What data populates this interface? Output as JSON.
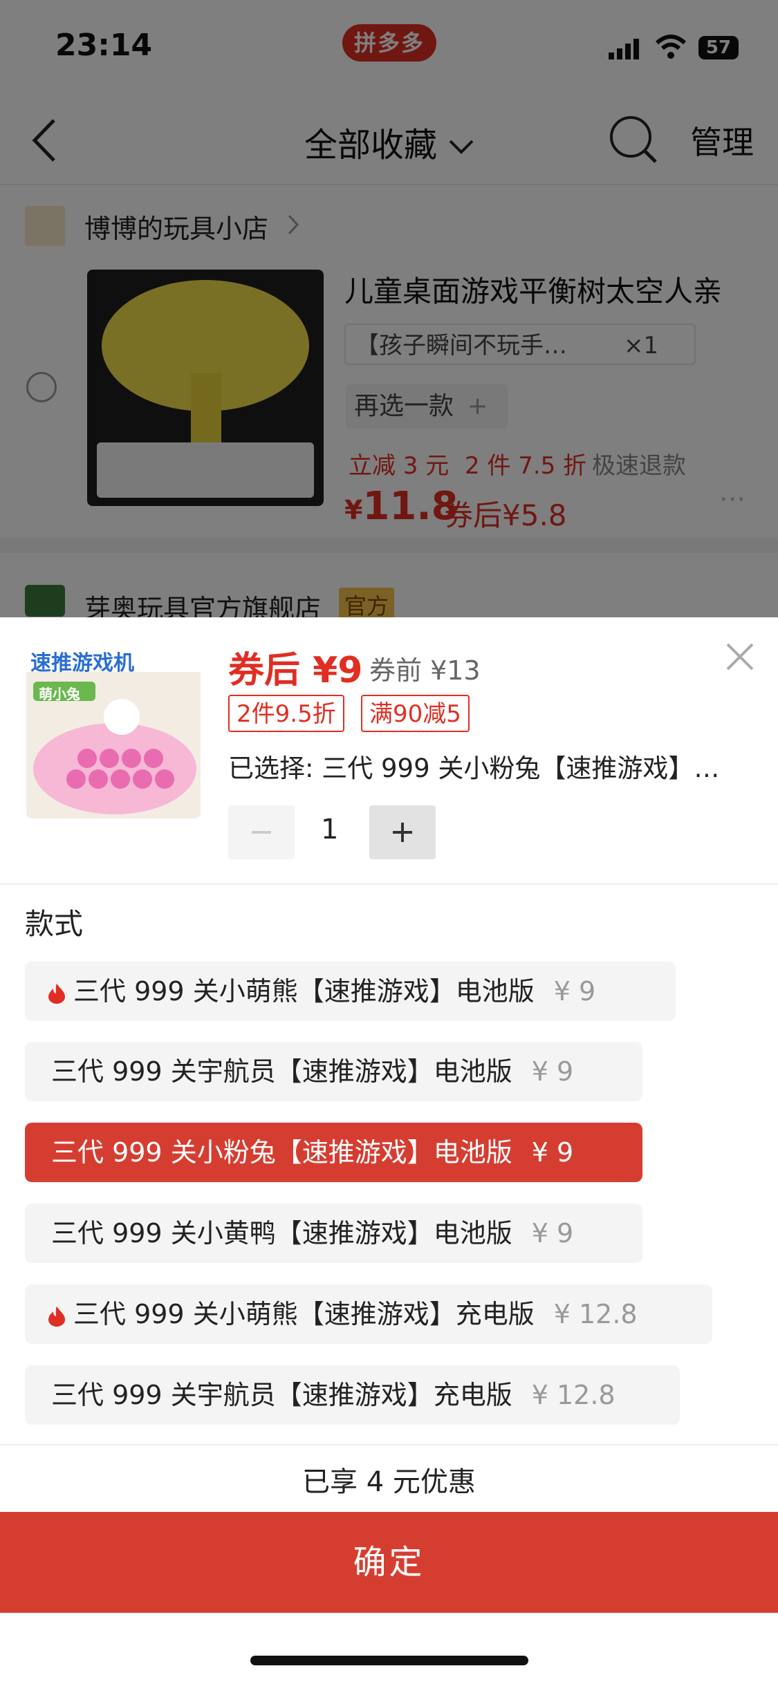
{
  "status_bar": {
    "time": "23:14",
    "app_badge": "拼多多",
    "battery": "57"
  },
  "nav": {
    "title": "全部收藏",
    "manage": "管理"
  },
  "background": {
    "shop1": {
      "name": "博博的玩具小店",
      "product_title": "儿童桌面游戏平衡树太空人亲",
      "spec": "【孩子瞬间不玩手…",
      "spec_qty": "×1",
      "choose_another": "再选一款",
      "promos": [
        "立减 3 元",
        "2 件 7.5 折",
        "极速退款"
      ],
      "price": "11.8",
      "price_after_coupon": "券后¥5.8"
    },
    "shop2": {
      "name": "芽奥玩具官方旗舰店",
      "badge": "官方"
    }
  },
  "sheet": {
    "thumb_text": "速推游戏机",
    "thumb_sub": "萌小兔",
    "after_coupon_price": "券后 ¥9",
    "before_coupon_price": "券前 ¥13",
    "tags": [
      "2件9.5折",
      "满90减5"
    ],
    "selected": "已选择: 三代 999 关小粉兔【速推游戏】…",
    "quantity": "1",
    "section_label": "款式",
    "options": [
      {
        "label": "三代 999 关小萌熊【速推游戏】电池版",
        "price": "¥ 9",
        "hot": true,
        "selected": false
      },
      {
        "label": "三代 999 关宇航员【速推游戏】电池版",
        "price": "¥ 9",
        "hot": false,
        "selected": false
      },
      {
        "label": "三代 999 关小粉兔【速推游戏】电池版",
        "price": "¥ 9",
        "hot": false,
        "selected": true
      },
      {
        "label": "三代 999 关小黄鸭【速推游戏】电池版",
        "price": "¥ 9",
        "hot": false,
        "selected": false
      },
      {
        "label": "三代 999 关小萌熊【速推游戏】充电版",
        "price": "¥ 12.8",
        "hot": true,
        "selected": false
      },
      {
        "label": "三代 999 关宇航员【速推游戏】充电版",
        "price": "¥ 12.8",
        "hot": false,
        "selected": false
      }
    ],
    "discount_text": "已享 4 元优惠",
    "confirm_label": "确定"
  },
  "colors": {
    "accent": "#d63d31",
    "price_red": "#e02e24"
  }
}
